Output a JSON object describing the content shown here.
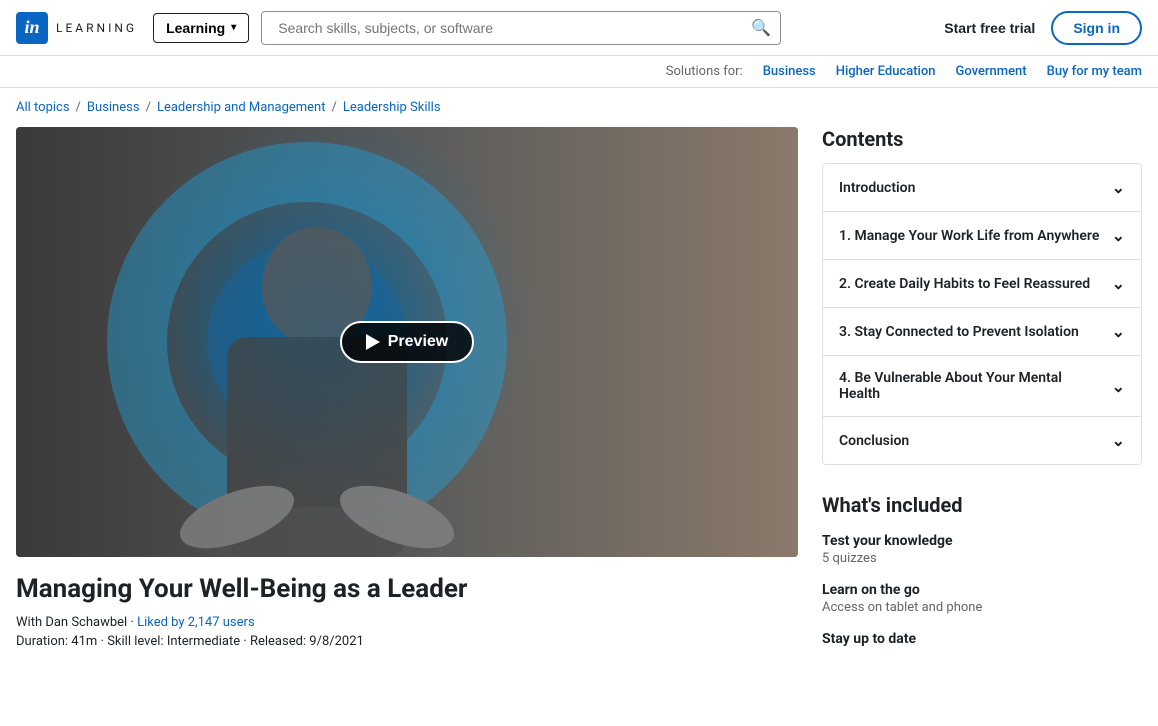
{
  "header": {
    "logo_in": "in",
    "logo_text": "LEARNING",
    "dropdown_label": "Learning",
    "search_placeholder": "Search skills, subjects, or software",
    "start_trial": "Start free trial",
    "sign_in": "Sign in"
  },
  "solutions_bar": {
    "label": "Solutions for:",
    "links": [
      "Business",
      "Higher Education",
      "Government",
      "Buy for my team"
    ]
  },
  "breadcrumb": {
    "items": [
      "All topics",
      "Business",
      "Leadership and Management",
      "Leadership Skills"
    ]
  },
  "course": {
    "title": "Managing Your Well-Being as a Leader",
    "author": "With Dan Schawbel",
    "liked": "Liked by 2,147 users",
    "duration": "Duration: 41m",
    "skill_level": "Skill level: Intermediate",
    "released": "Released: 9/8/2021",
    "preview_label": "Preview"
  },
  "contents": {
    "title": "Contents",
    "items": [
      {
        "label": "Introduction"
      },
      {
        "label": "1. Manage Your Work Life from Anywhere"
      },
      {
        "label": "2. Create Daily Habits to Feel Reassured"
      },
      {
        "label": "3. Stay Connected to Prevent Isolation"
      },
      {
        "label": "4. Be Vulnerable About Your Mental Health"
      },
      {
        "label": "Conclusion"
      }
    ]
  },
  "whats_included": {
    "title": "What's included",
    "items": [
      {
        "title": "Test your knowledge",
        "sub": "5 quizzes"
      },
      {
        "title": "Learn on the go",
        "sub": "Access on tablet and phone"
      },
      {
        "title": "Stay up to date",
        "sub": ""
      }
    ]
  }
}
